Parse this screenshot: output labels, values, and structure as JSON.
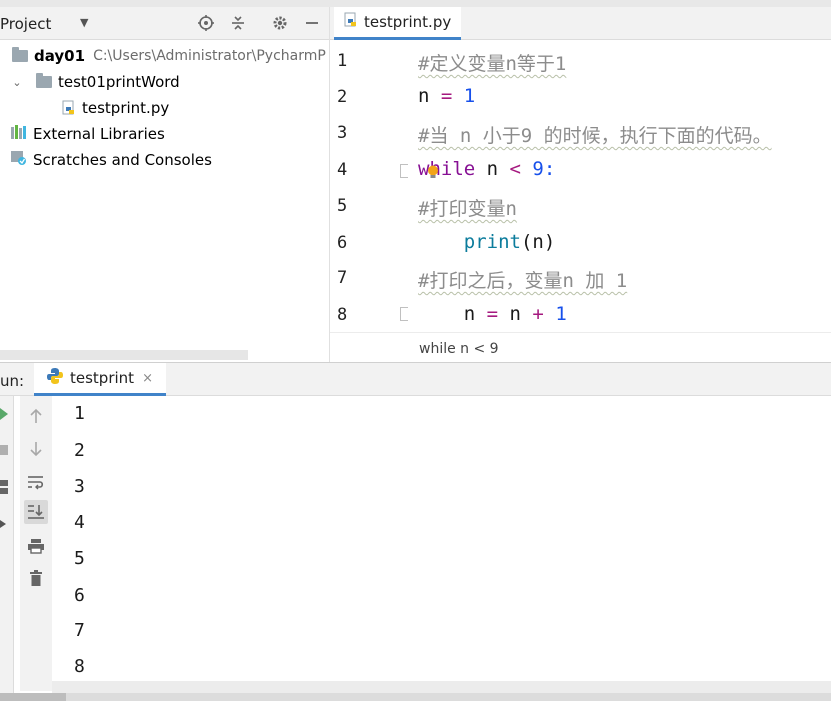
{
  "project_panel": {
    "title": "Project",
    "caret": "▼",
    "tree": [
      {
        "label": "day01",
        "path": "C:\\Users\\Administrator\\PycharmP"
      },
      {
        "label": "test01printWord"
      },
      {
        "label": "testprint.py"
      },
      {
        "label": "External Libraries"
      },
      {
        "label": "Scratches and Consoles"
      }
    ]
  },
  "editor": {
    "tab_label": "testprint.py",
    "line_numbers": [
      "1",
      "2",
      "3",
      "4",
      "5",
      "6",
      "7",
      "8"
    ],
    "code": {
      "l1": "#定义变量n等于1",
      "l2_a": "n ",
      "l2_op": "=",
      "l2_num": " 1",
      "l3": "#当 n 小于9 的时候，执行下面的代码。",
      "l4_kw": "while",
      "l4_a": " n ",
      "l4_op": "<",
      "l4_num": " 9",
      "l4_colon": ":",
      "l5": "#打印变量n",
      "l6_fn": "    print",
      "l6_a": "(n)",
      "l7": "#打印之后，变量n 加 1",
      "l8_a": "    n ",
      "l8_op1": "=",
      "l8_b": " n ",
      "l8_op2": "+",
      "l8_num": " 1"
    },
    "breadcrumb": "while n < 9"
  },
  "run_panel": {
    "label": "un:",
    "tab_label": "testprint",
    "tab_close": "×",
    "output": [
      "1",
      "2",
      "3",
      "4",
      "5",
      "6",
      "7",
      "8"
    ]
  },
  "colors": {
    "accent": "#4083c9",
    "current_line": "#fcf5d6",
    "run_green": "#59a869"
  }
}
